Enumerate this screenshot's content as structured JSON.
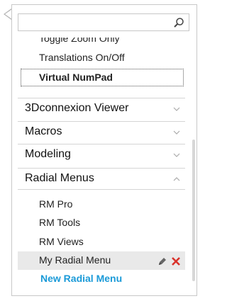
{
  "search": {
    "value": "",
    "placeholder": ""
  },
  "items_above": [
    {
      "label": "Toggle Zoom Only"
    },
    {
      "label": "Translations On/Off"
    },
    {
      "label": "Virtual NumPad"
    }
  ],
  "sections": [
    {
      "label": "3Dconnexion Viewer",
      "expanded": false
    },
    {
      "label": "Macros",
      "expanded": false
    },
    {
      "label": "Modeling",
      "expanded": false
    },
    {
      "label": "Radial Menus",
      "expanded": true
    }
  ],
  "radial_menus": [
    {
      "label": "RM Pro"
    },
    {
      "label": "RM Tools"
    },
    {
      "label": "RM Views"
    },
    {
      "label": "My Radial Menu"
    }
  ],
  "new_radial_menu_label": "New Radial Menu",
  "colors": {
    "link": "#1a9ad8",
    "delete": "#d9322b",
    "hover_row": "#e9e9e9"
  }
}
